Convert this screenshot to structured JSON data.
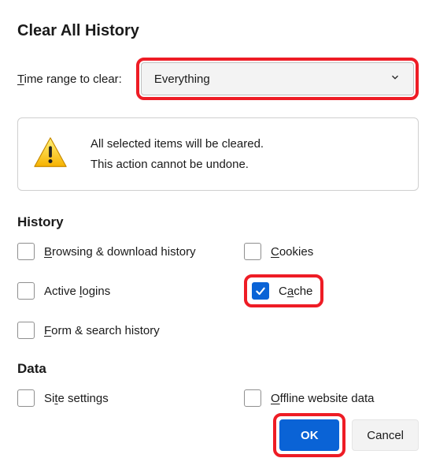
{
  "title": "Clear All History",
  "timeRange": {
    "label_pre": "T",
    "label_rest": "ime range to clear:",
    "selected": "Everything"
  },
  "warning": {
    "line1": "All selected items will be cleared.",
    "line2": "This action cannot be undone."
  },
  "sections": {
    "history": {
      "heading": "History"
    },
    "data": {
      "heading": "Data"
    }
  },
  "checkboxes": {
    "browsing": {
      "pre": "B",
      "rest": "rowsing & download history",
      "checked": false
    },
    "cookies": {
      "pre": "C",
      "rest": "ookies",
      "checked": false
    },
    "logins": {
      "pre_plain": "Active ",
      "pre": "l",
      "rest": "ogins",
      "checked": false
    },
    "cache": {
      "pre_plain": "C",
      "pre": "a",
      "rest": "che",
      "checked": true
    },
    "form": {
      "pre": "F",
      "rest": "orm & search history",
      "checked": false
    },
    "site": {
      "pre_plain": "Si",
      "pre": "t",
      "rest": "e settings",
      "checked": false
    },
    "offline": {
      "pre": "O",
      "rest": "ffline website data",
      "checked": false
    }
  },
  "buttons": {
    "ok": "OK",
    "cancel": "Cancel"
  }
}
